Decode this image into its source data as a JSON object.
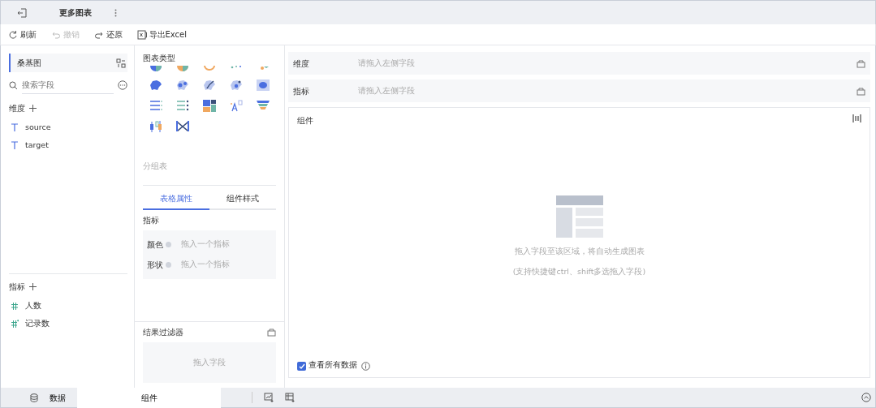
{
  "header": {
    "title": "更多图表"
  },
  "toolbar": [
    {
      "label": "刷新",
      "disabled": false
    },
    {
      "label": "撤销",
      "disabled": true
    },
    {
      "label": "还原",
      "disabled": false
    },
    {
      "label": "导出Excel",
      "disabled": false
    }
  ],
  "left": {
    "chart_name": "桑基图",
    "search": {
      "placeholder": "搜索字段"
    },
    "dimension": {
      "title": "维度",
      "fields": [
        {
          "name": "source",
          "kind": "text"
        },
        {
          "name": "target",
          "kind": "text"
        }
      ]
    },
    "measure": {
      "title": "指标",
      "fields": [
        {
          "name": "人数",
          "kind": "number"
        },
        {
          "name": "记录数",
          "kind": "count"
        }
      ]
    }
  },
  "middle": {
    "chart_types_title": "图表类型",
    "group_label": "分组表",
    "tabs": [
      {
        "label": "表格属性",
        "selected": true
      },
      {
        "label": "组件样式",
        "selected": false
      }
    ],
    "section_title": "指标",
    "slots": [
      {
        "label": "颜色",
        "hint": "拖入一个指标"
      },
      {
        "label": "形状",
        "hint": "拖入一个指标"
      }
    ],
    "filter": {
      "title": "结果过滤器",
      "hint": "拖入字段"
    }
  },
  "right": {
    "shelves": [
      {
        "label": "维度",
        "hint": "请拖入左侧字段"
      },
      {
        "label": "指标",
        "hint": "请拖入左侧字段"
      }
    ],
    "canvas": {
      "title": "组件",
      "hint": "拖入字段至该区域，将自动生成图表",
      "sub_hint": "(支持快捷键ctrl、shift多选拖入字段)",
      "show_all": {
        "label": "查看所有数据",
        "checked": true
      }
    }
  },
  "bottom_tabs": [
    {
      "label": "数据",
      "selected": false
    },
    {
      "label": "组件",
      "selected": true
    }
  ]
}
